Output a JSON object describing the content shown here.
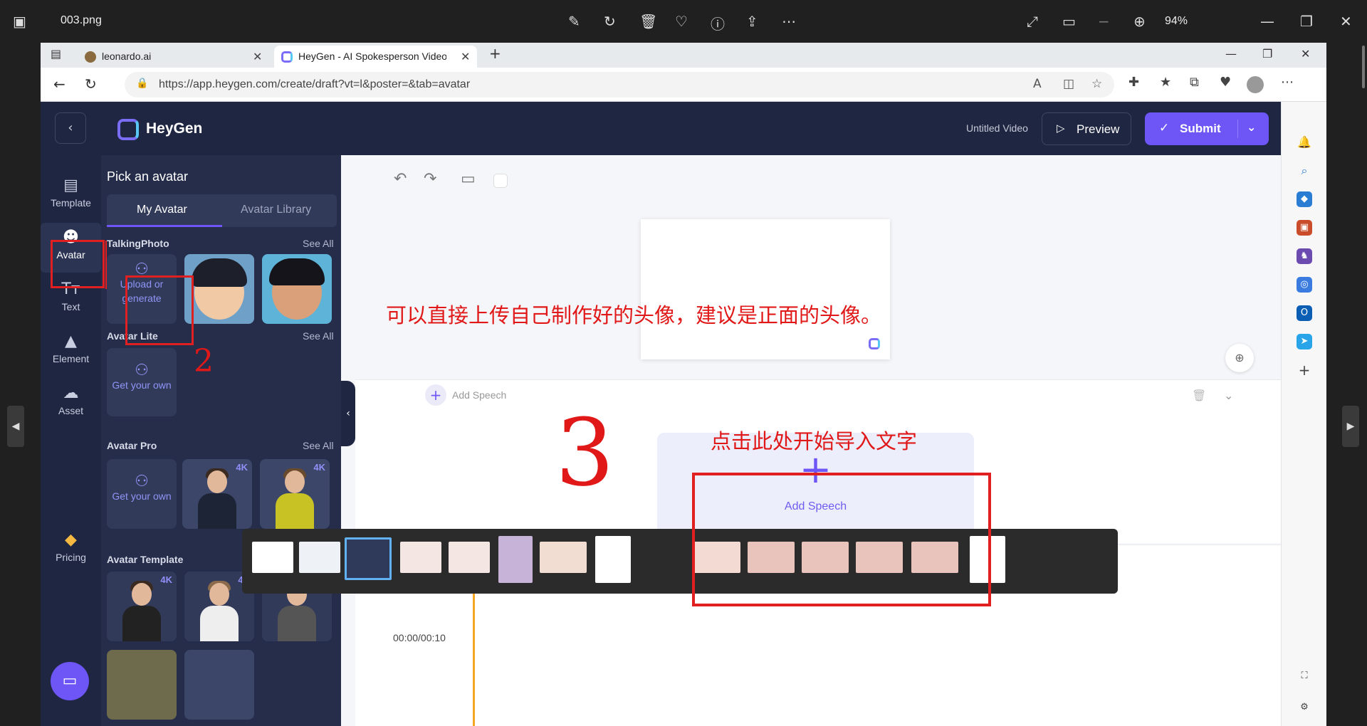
{
  "viewer": {
    "filename": "003.png",
    "zoom": "94%"
  },
  "browser": {
    "tabs": [
      {
        "title": "leonardo.ai"
      },
      {
        "title": "HeyGen - AI Spokesperson Video"
      }
    ],
    "url": "https://app.heygen.com/create/draft?vt=l&poster=&tab=avatar"
  },
  "header": {
    "brand": "HeyGen",
    "video_title": "Untitled Video",
    "preview_label": "Preview",
    "submit_label": "Submit"
  },
  "left_nav": {
    "items": [
      {
        "label": "Template",
        "icon": "template-icon"
      },
      {
        "label": "Avatar",
        "icon": "avatar-icon"
      },
      {
        "label": "Text",
        "icon": "text-icon"
      },
      {
        "label": "Element",
        "icon": "element-icon"
      },
      {
        "label": "Asset",
        "icon": "asset-icon"
      }
    ],
    "pricing_label": "Pricing"
  },
  "panel": {
    "title": "Pick an avatar",
    "tabs": [
      "My Avatar",
      "Avatar Library"
    ],
    "see_all": "See All",
    "sections": {
      "talking_photo": "TalkingPhoto",
      "avatar_lite": "Avatar Lite",
      "avatar_pro": "Avatar Pro",
      "avatar_template": "Avatar Template"
    },
    "upload_label": "Upload or generate",
    "get_your_own": "Get your own",
    "badge_4k": "4K"
  },
  "canvas": {
    "add_speech_small": "Add Speech",
    "add_speech_big": "Add Speech",
    "timecode": "00:00/00:10"
  },
  "annotations": {
    "upload_note": "可以直接上传自己制作好的头像，建议是正面的头像。",
    "speech_note": "点击此处开始导入文字",
    "mark_2": "2",
    "mark_3": "3"
  },
  "colors": {
    "accent": "#6d55f6",
    "dark_bg": "#1f2642",
    "annotation_red": "#e02020"
  }
}
